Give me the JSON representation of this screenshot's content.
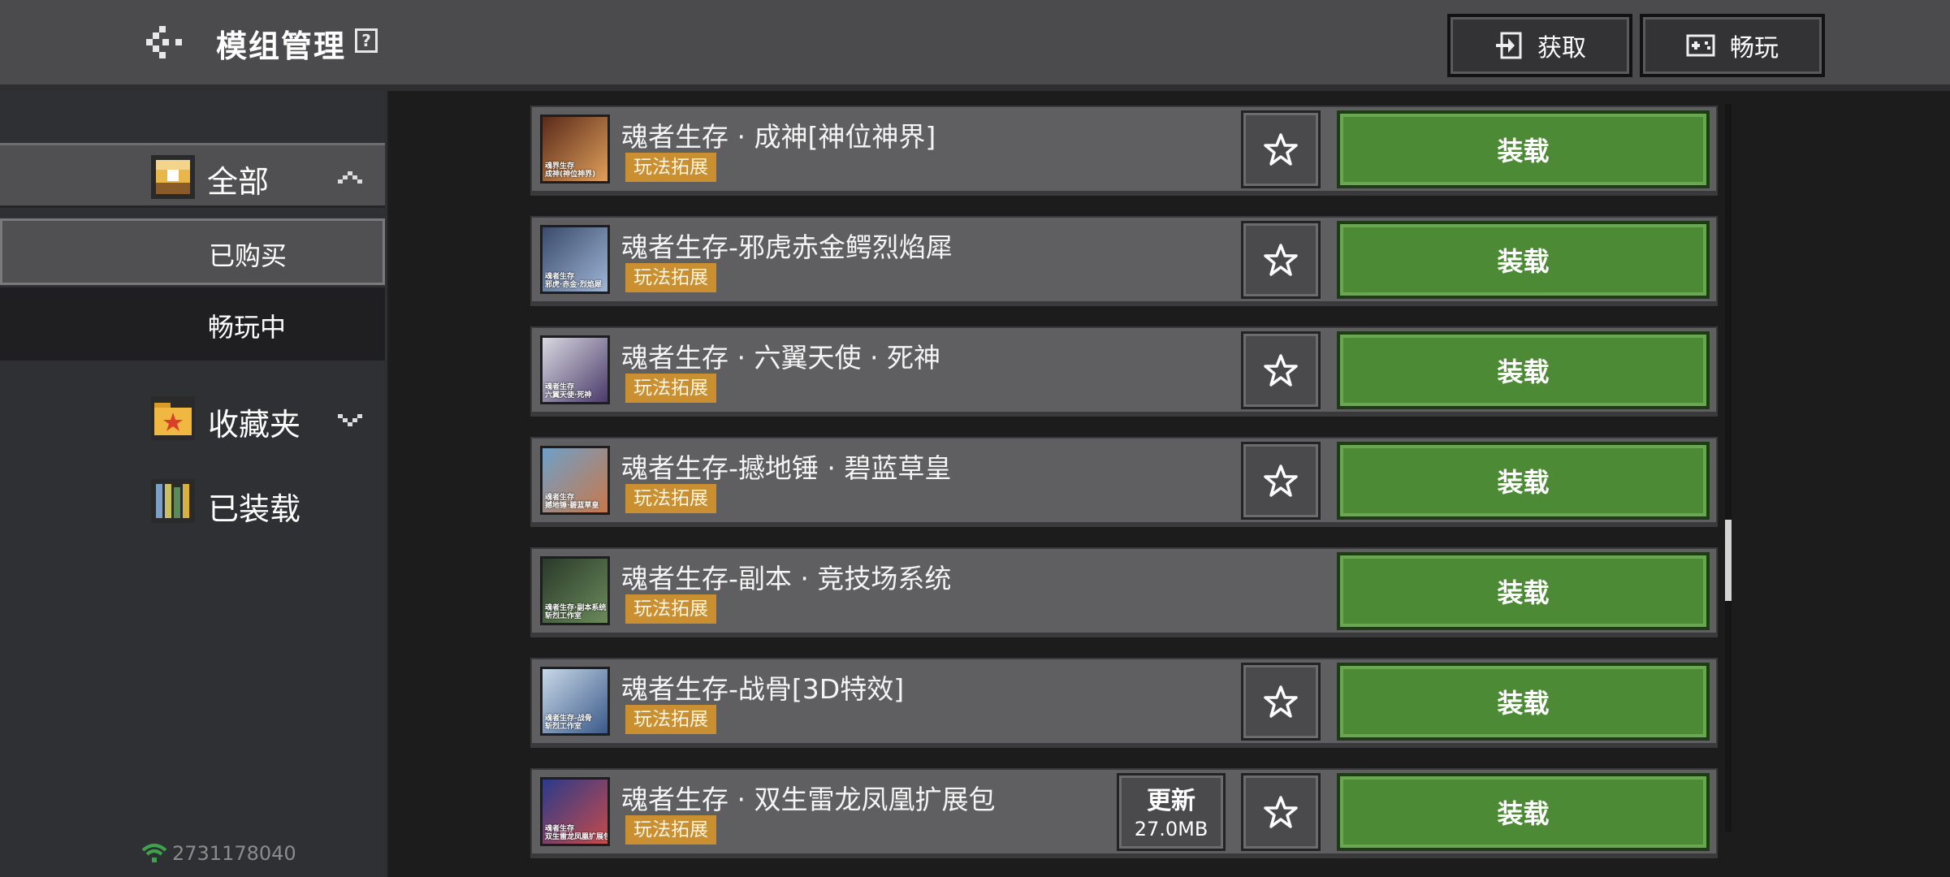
{
  "header": {
    "title": "模组管理",
    "help": "?",
    "acquire_label": "获取",
    "play_label": "畅玩"
  },
  "sidebar": {
    "all_label": "全部",
    "purchased_label": "已购买",
    "playing_label": "畅玩中",
    "favorites_label": "收藏夹",
    "loaded_label": "已装载",
    "device_id": "2731178040"
  },
  "mods": [
    {
      "name": "魂者生存 · 成神[神位神界]",
      "tag": "玩法拓展",
      "action": "装载",
      "thumb_caption": "魂界生存\n成神(神位神界)",
      "thumb_colors": [
        "#5a2a1a",
        "#e0a05a"
      ],
      "has_star": true
    },
    {
      "name": "魂者生存-邪虎赤金鳄烈焰犀",
      "tag": "玩法拓展",
      "action": "装载",
      "thumb_caption": "魂者生存\n邪虎·赤金·烈焰犀",
      "thumb_colors": [
        "#3a4a6a",
        "#9fb6d6"
      ],
      "has_star": true
    },
    {
      "name": "魂者生存 · 六翼天使 · 死神",
      "tag": "玩法拓展",
      "action": "装载",
      "thumb_caption": "魂者生存\n六翼天使·死神",
      "thumb_colors": [
        "#d8d8e0",
        "#4a3a6a"
      ],
      "has_star": true
    },
    {
      "name": "魂者生存-撼地锤 · 碧蓝草皇",
      "tag": "玩法拓展",
      "action": "装载",
      "thumb_caption": "魂者生存\n撼地锤·碧蓝草皇",
      "thumb_colors": [
        "#6fa0c8",
        "#c8784a"
      ],
      "has_star": true
    },
    {
      "name": "魂者生存-副本 · 竞技场系统",
      "tag": "玩法拓展",
      "action": "装载",
      "thumb_caption": "魂者生存·副本系统\n斩烈工作室",
      "thumb_colors": [
        "#2a3a2a",
        "#6a8a5a"
      ],
      "has_star": false
    },
    {
      "name": "魂者生存-战骨[3D特效]",
      "tag": "玩法拓展",
      "action": "装载",
      "thumb_caption": "魂者生存-战骨\n斩烈工作室",
      "thumb_colors": [
        "#c8d8e8",
        "#3a5a8a"
      ],
      "has_star": true
    },
    {
      "name": "魂者生存 · 双生雷龙凤凰扩展包",
      "tag": "玩法拓展",
      "action": "装载",
      "thumb_caption": "魂者生存\n双生雷龙凤凰扩展包",
      "thumb_colors": [
        "#2a3a8a",
        "#c84a4a"
      ],
      "has_star": true,
      "update_label": "更新",
      "update_size": "27.0MB"
    }
  ]
}
